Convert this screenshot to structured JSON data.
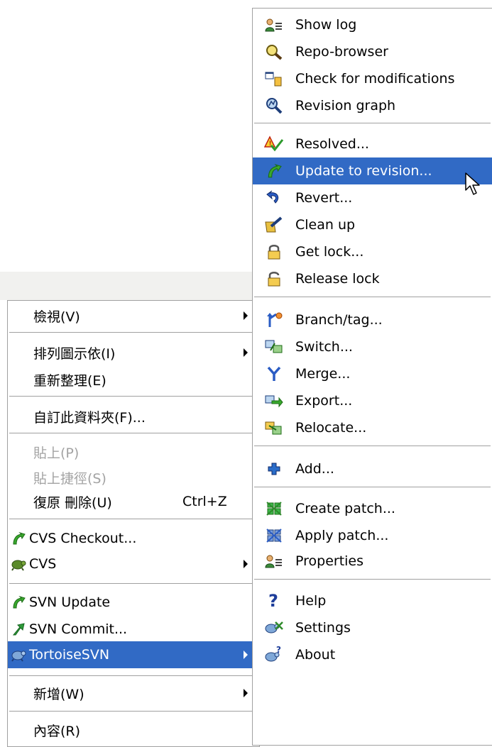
{
  "explorer_menu": {
    "items": [
      {
        "label": "檢視(V)",
        "submenu": true
      },
      {
        "label": "排列圖示依(I)",
        "submenu": true
      },
      {
        "label": "重新整理(E)"
      },
      {
        "label": "自訂此資料夾(F)..."
      },
      {
        "label": "貼上(P)",
        "disabled": true
      },
      {
        "label": "貼上捷徑(S)",
        "disabled": true
      },
      {
        "label": "復原 刪除(U)",
        "shortcut": "Ctrl+Z"
      },
      {
        "label": "CVS Checkout..."
      },
      {
        "label": "CVS",
        "submenu": true
      },
      {
        "label": "SVN Update"
      },
      {
        "label": "SVN Commit..."
      },
      {
        "label": "TortoiseSVN",
        "submenu": true,
        "highlighted": true
      },
      {
        "label": "新增(W)",
        "submenu": true
      },
      {
        "label": "內容(R)"
      }
    ]
  },
  "tortoisesvn_menu": {
    "items": [
      {
        "label": "Show log",
        "icon": "show-log-icon"
      },
      {
        "label": "Repo-browser",
        "icon": "repo-browser-icon"
      },
      {
        "label": "Check for modifications",
        "icon": "check-modifications-icon"
      },
      {
        "label": "Revision graph",
        "icon": "revision-graph-icon"
      },
      {
        "label": "Resolved...",
        "icon": "resolved-icon"
      },
      {
        "label": "Update to revision...",
        "icon": "update-icon",
        "highlighted": true
      },
      {
        "label": "Revert...",
        "icon": "revert-icon"
      },
      {
        "label": "Clean up",
        "icon": "cleanup-icon"
      },
      {
        "label": "Get lock...",
        "icon": "lock-icon"
      },
      {
        "label": "Release lock",
        "icon": "unlock-icon"
      },
      {
        "label": "Branch/tag...",
        "icon": "branch-icon"
      },
      {
        "label": "Switch...",
        "icon": "switch-icon"
      },
      {
        "label": "Merge...",
        "icon": "merge-icon"
      },
      {
        "label": "Export...",
        "icon": "export-icon"
      },
      {
        "label": "Relocate...",
        "icon": "relocate-icon"
      },
      {
        "label": "Add...",
        "icon": "add-icon"
      },
      {
        "label": "Create patch...",
        "icon": "create-patch-icon"
      },
      {
        "label": "Apply patch...",
        "icon": "apply-patch-icon"
      },
      {
        "label": "Properties",
        "icon": "properties-icon"
      },
      {
        "label": "Help",
        "icon": "help-icon"
      },
      {
        "label": "Settings",
        "icon": "settings-icon"
      },
      {
        "label": "About",
        "icon": "about-icon"
      }
    ]
  },
  "colors": {
    "highlight": "#316ac5",
    "highlight_text": "#ffffff",
    "disabled_text": "#a3a3a3",
    "separator": "#a0a0a0"
  }
}
